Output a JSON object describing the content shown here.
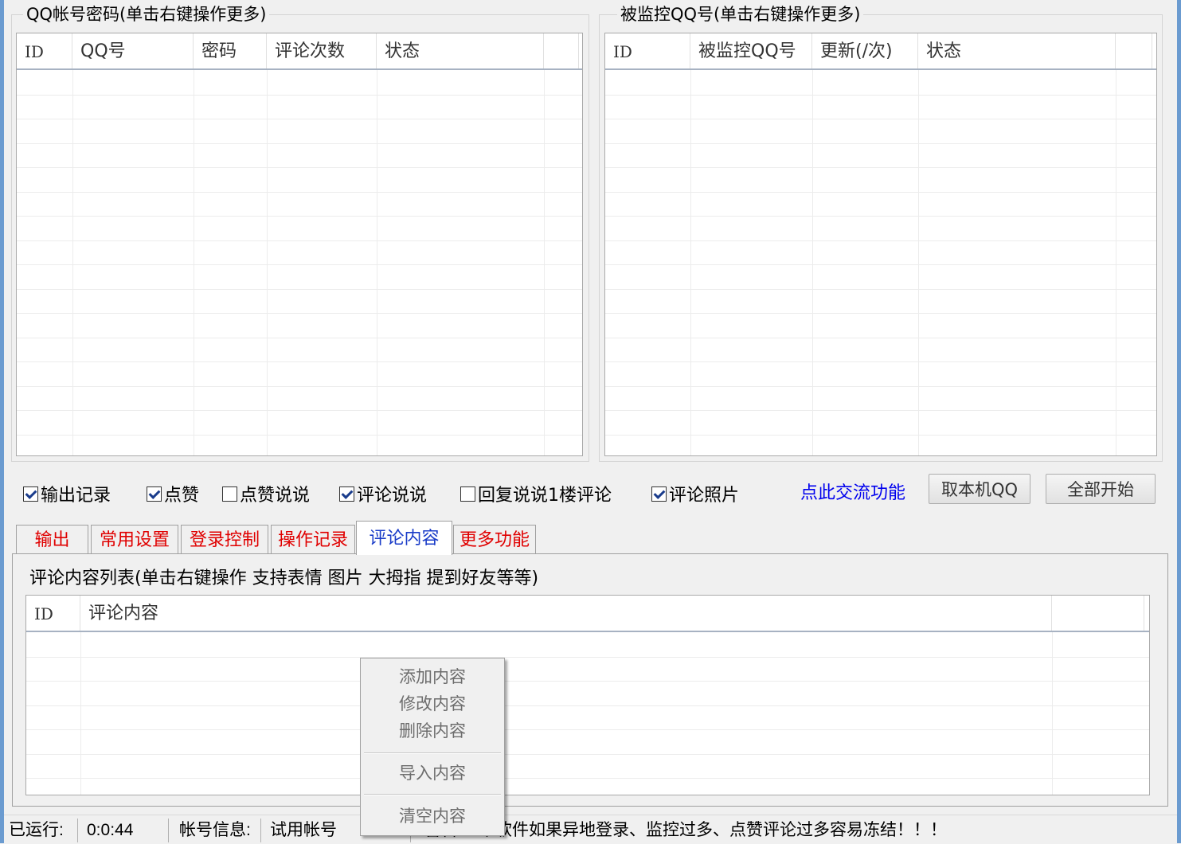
{
  "accounts_panel": {
    "title": "QQ帐号密码(单击右键操作更多)",
    "columns": [
      "ID",
      "QQ号",
      "密码",
      "评论次数",
      "状态"
    ]
  },
  "monitored_panel": {
    "title": "被监控QQ号(单击右键操作更多)",
    "columns": [
      "ID",
      "被监控QQ号",
      "更新(/次)",
      "状态"
    ]
  },
  "options": [
    {
      "label": "输出记录",
      "checked": true
    },
    {
      "label": "点赞",
      "checked": true
    },
    {
      "label": "点赞说说",
      "checked": false
    },
    {
      "label": "评论说说",
      "checked": true
    },
    {
      "label": "回复说说1楼评论",
      "checked": false
    },
    {
      "label": "评论照片",
      "checked": true
    }
  ],
  "exchange_link": "点此交流功能",
  "buttons": {
    "get_local_qq": "取本机QQ",
    "start_all": "全部开始"
  },
  "tabs": [
    "输出",
    "常用设置",
    "登录控制",
    "操作记录",
    "评论内容",
    "更多功能"
  ],
  "active_tab": "评论内容",
  "comment_panel": {
    "title": "评论内容列表(单击右键操作 支持表情 图片 大拇指 提到好友等等)",
    "columns": [
      "ID",
      "评论内容"
    ]
  },
  "context_menu": {
    "items": [
      "添加内容",
      "修改内容",
      "删除内容",
      "导入内容",
      "清空内容"
    ]
  },
  "status_bar": {
    "runtime_label": "已运行:",
    "runtime_value": "0:0:44",
    "account_label": "帐号信息:",
    "account_value": "试用帐号",
    "notice_prefix": "警告:",
    "notice": "本软件如果异地登录、监控过多、点赞评论过多容易冻结！！！"
  },
  "colors": {
    "tab_text": "#e00000",
    "active_tab_text": "#1a3cc8",
    "link": "#0000ee",
    "frame": "#6b9bd0"
  }
}
